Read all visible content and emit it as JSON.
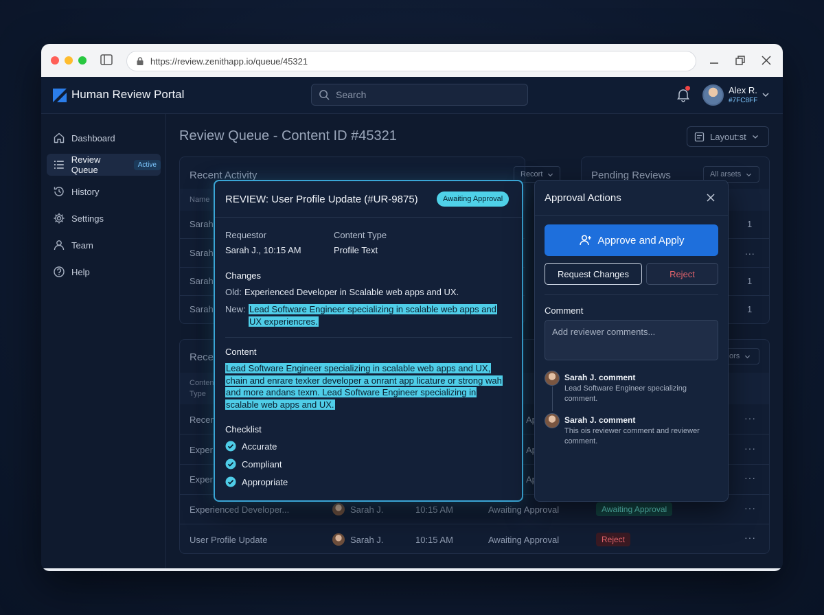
{
  "browser": {
    "url": "https://review.zenithapp.io/queue/45321"
  },
  "header": {
    "app_title": "Human Review Portal",
    "search_placeholder": "Search",
    "user_name": "Alex R.",
    "user_id": "#7FC8FF"
  },
  "sidebar": {
    "items": [
      {
        "label": "Dashboard",
        "icon": "home-icon"
      },
      {
        "label": "Review Queue",
        "icon": "list-icon",
        "badge": "Active"
      },
      {
        "label": "History",
        "icon": "history-icon"
      },
      {
        "label": "Settings",
        "icon": "gear-icon"
      },
      {
        "label": "Team",
        "icon": "user-icon"
      },
      {
        "label": "Help",
        "icon": "help-icon"
      }
    ]
  },
  "main": {
    "page_title": "Review Queue - Content ID #45321",
    "layout_label": "Layout:st"
  },
  "recent_activity": {
    "title": "Recent Activity",
    "filter": "Recort",
    "col_name": "Name",
    "rows": [
      "Sarah",
      "Sarah",
      "Sarah",
      "Sarah"
    ]
  },
  "pending_reviews": {
    "title": "Pending Reviews",
    "filter": "All arsets",
    "rows": [
      "1",
      "...",
      "1",
      "1"
    ]
  },
  "recent_table": {
    "title": "Rece",
    "filter": "ors",
    "col_content": "Conten",
    "col_type": "Type",
    "rows": [
      {
        "item": "Recen",
        "status_frag": "Ap"
      },
      {
        "item": "Exper",
        "status_frag": "Ap"
      },
      {
        "item": "Exper",
        "status_frag": "Ap"
      },
      {
        "item": "Experienced Developer...",
        "user": "Sarah J.",
        "time": "10:15 AM",
        "status": "Awaiting Approval",
        "pill": "Awaiting Approval"
      },
      {
        "item": "User Profile Update",
        "user": "Sarah J.",
        "time": "10:15 AM",
        "status": "Awaiting Approval",
        "pill": "Reject"
      }
    ]
  },
  "review": {
    "title": "REVIEW: User Profile Update (#UR-9875)",
    "status": "Awaiting Approval",
    "requestor_label": "Requestor",
    "requestor_value": "Sarah J., 10:15 AM",
    "content_type_label": "Content Type",
    "content_type_value": "Profile Text",
    "changes_heading": "Changes",
    "old_label": "Old:",
    "old_text": "Experienced Developer in Scalable web apps and UX.",
    "new_label": "New:",
    "new_text": "Lead Software Engineer specializing in scalable web apps and UX experiencres.",
    "content_heading": "Content",
    "content_text": "Lead Software Engineer specializing in scalable web apps and UX, chain and enrare texker developer a onrant app licature or strong wah and more andans texm. Lead Software Engineer specializing in scalable web apps and UX.",
    "checklist_heading": "Checklist",
    "checklist": [
      "Accurate",
      "Compliant",
      "Appropriate"
    ]
  },
  "approval": {
    "title": "Approval Actions",
    "approve_label": "Approve and Apply",
    "request_changes_label": "Request Changes",
    "reject_label": "Reject",
    "comment_label": "Comment",
    "comment_placeholder": "Add reviewer comments...",
    "comments": [
      {
        "author": "Sarah J. comment",
        "text": "Lead Software Engineer specializing comment."
      },
      {
        "author": "Sarah J. comment",
        "text": "This ois reviewer comment and reviewer comment."
      }
    ]
  },
  "colors": {
    "accent": "#4fcde8",
    "primary_button": "#1e6fdc",
    "reject": "#e0636b",
    "background": "#0f1a2e"
  }
}
